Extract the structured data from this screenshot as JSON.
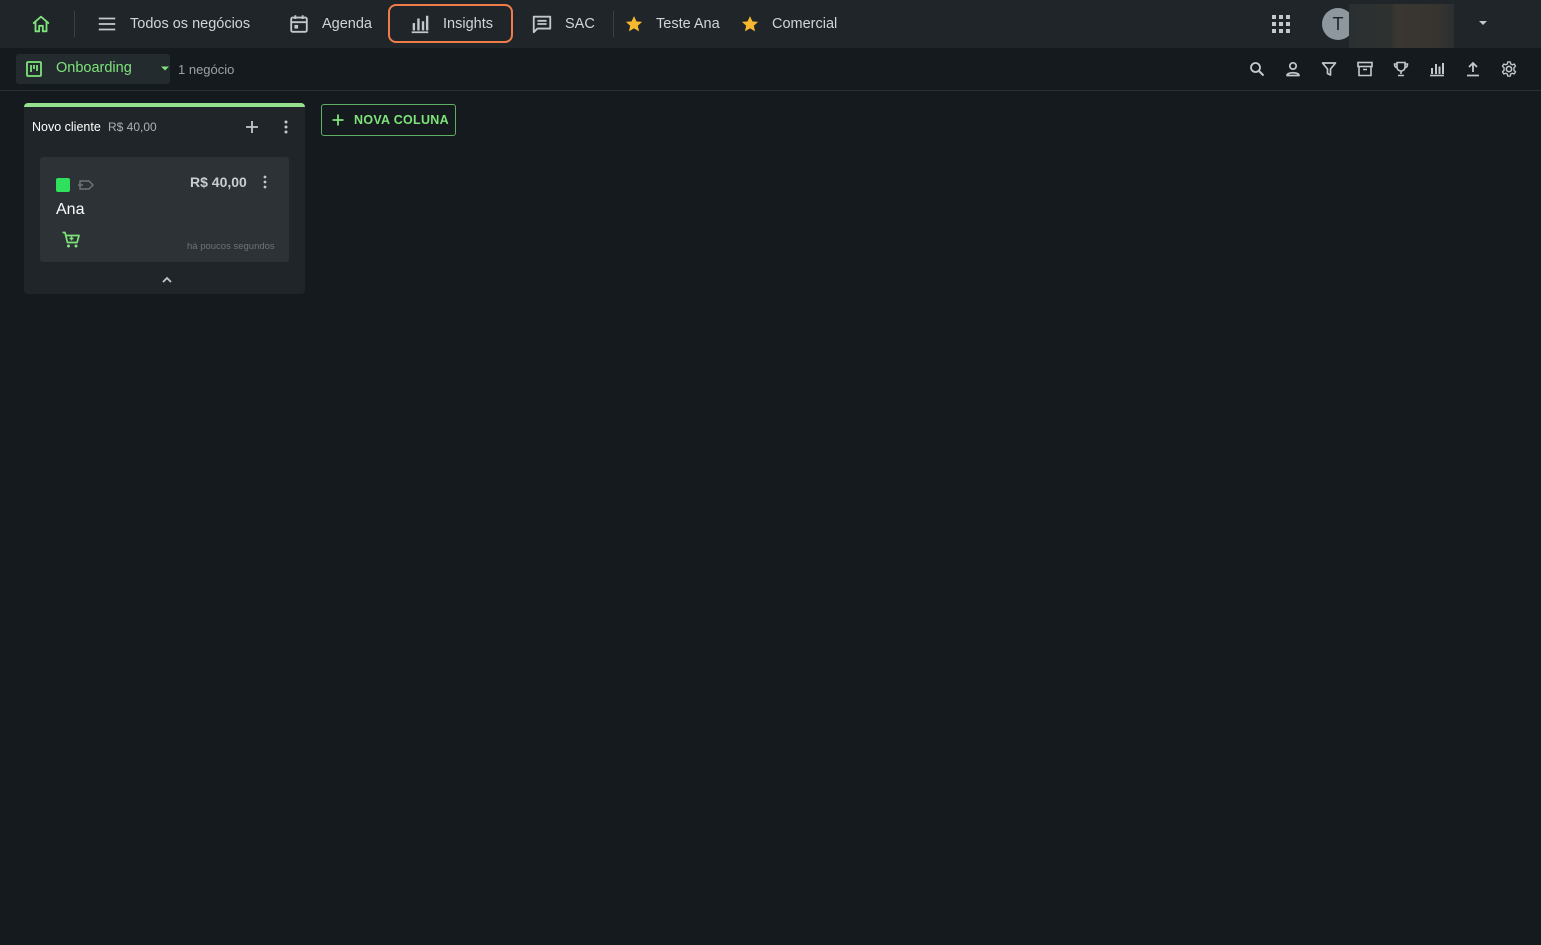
{
  "colors": {
    "accent": "#7ee37a",
    "active_outline": "#ef7d4a",
    "star": "#f5b82e",
    "status_green": "#2ee05c",
    "background": "#141a1d",
    "topbar": "#1f2529"
  },
  "topnav": {
    "home_icon": "home-icon",
    "items": [
      {
        "label": "Todos os negócios",
        "icon": "menu-lines-icon"
      },
      {
        "label": "Agenda",
        "icon": "calendar-icon"
      },
      {
        "label": "Insights",
        "icon": "bar-chart-icon",
        "active": true
      },
      {
        "label": "SAC",
        "icon": "chat-icon"
      },
      {
        "label": "Teste Ana",
        "icon": "star-icon"
      },
      {
        "label": "Comercial",
        "icon": "star-icon"
      }
    ],
    "avatar_initial": "T"
  },
  "subbar": {
    "pipeline_name": "Onboarding",
    "deal_count": "1 negócio",
    "tools": [
      "search-icon",
      "person-icon",
      "filter-icon",
      "archive-icon",
      "trophy-icon",
      "chart-icon",
      "upload-icon",
      "gear-icon"
    ]
  },
  "board": {
    "columns": [
      {
        "title": "Novo cliente",
        "total": "R$ 40,00",
        "cards": [
          {
            "name": "Ana",
            "value": "R$ 40,00",
            "time": "há poucos segundos"
          }
        ]
      }
    ],
    "new_column_label": "NOVA COLUNA"
  }
}
